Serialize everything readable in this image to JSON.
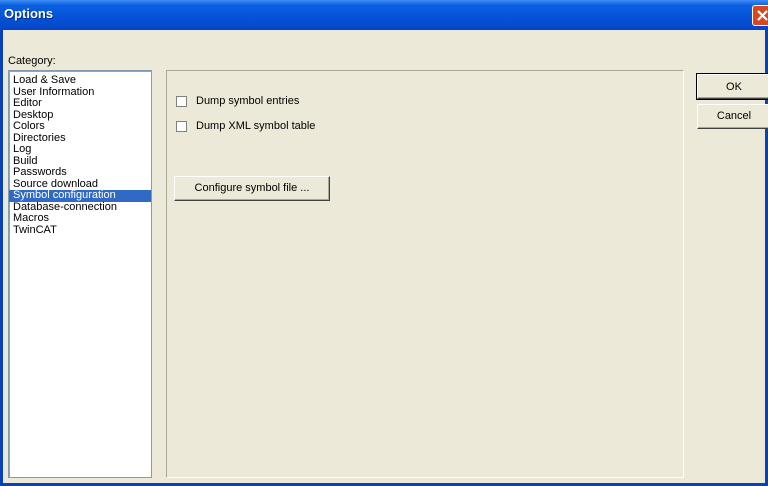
{
  "window": {
    "title": "Options",
    "title_color": "#0552d8",
    "close_color": "#d8471f"
  },
  "category": {
    "label": "Category:",
    "selected_index": 10,
    "selected_color": "#316ac5",
    "items": [
      "Load & Save",
      "User Information",
      "Editor",
      "Desktop",
      "Colors",
      "Directories",
      "Log",
      "Build",
      "Passwords",
      "Source download",
      "Symbol configuration",
      "Database-connection",
      "Macros",
      "TwinCAT"
    ]
  },
  "settings": {
    "dump_symbol_entries": {
      "label": "Dump symbol entries",
      "checked": false
    },
    "dump_xml_symbol_table": {
      "label": "Dump XML symbol table",
      "checked": false
    },
    "configure_button": "Configure symbol file ..."
  },
  "buttons": {
    "ok": "OK",
    "cancel": "Cancel"
  },
  "icons": {
    "close": "close-icon"
  }
}
